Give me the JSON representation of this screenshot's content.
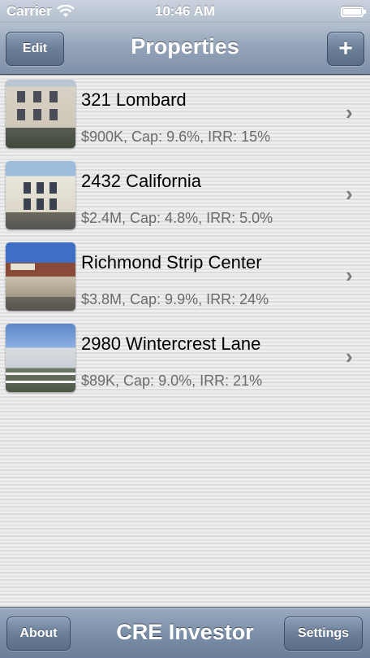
{
  "status_bar": {
    "carrier": "Carrier",
    "time": "10:46 AM"
  },
  "nav": {
    "title": "Properties",
    "edit_label": "Edit",
    "add_label": "+"
  },
  "properties": [
    {
      "name": "321 Lombard",
      "details": "$900K, Cap: 9.6%, IRR: 15%"
    },
    {
      "name": "2432 California",
      "details": "$2.4M, Cap: 4.8%, IRR: 5.0%"
    },
    {
      "name": "Richmond Strip Center",
      "details": "$3.8M, Cap: 9.9%, IRR: 24%"
    },
    {
      "name": "2980 Wintercrest Lane",
      "details": "$89K, Cap: 9.0%, IRR: 21%"
    }
  ],
  "bottom_bar": {
    "about_label": "About",
    "title": "CRE Investor",
    "settings_label": "Settings"
  }
}
